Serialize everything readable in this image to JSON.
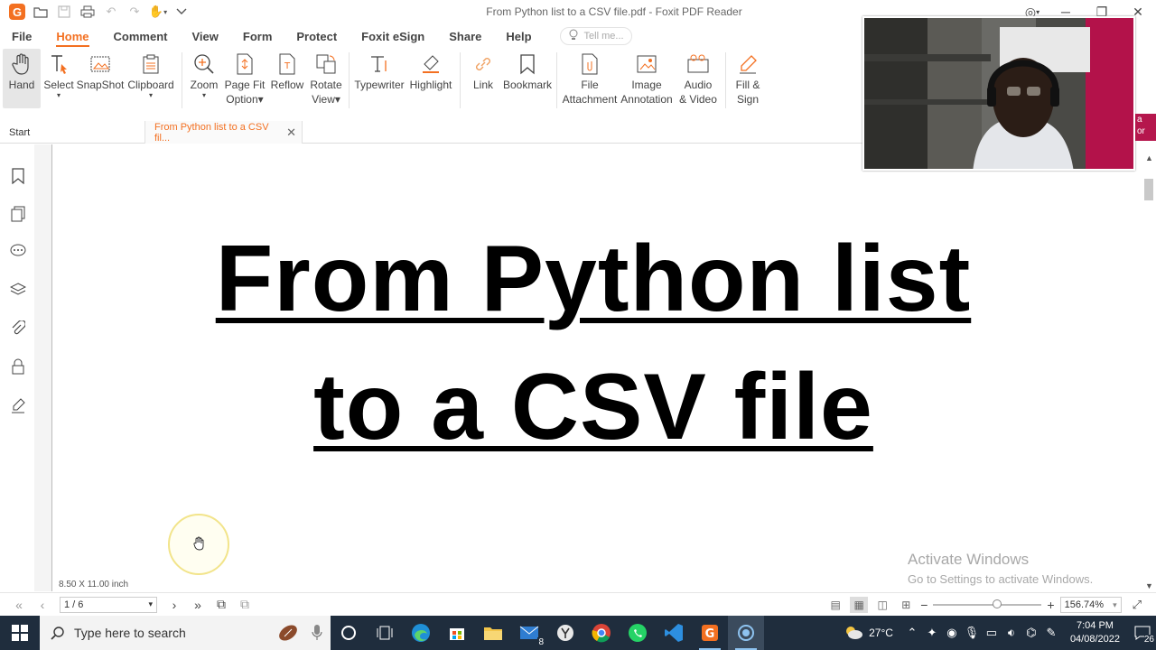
{
  "window": {
    "title": "From Python list to a CSV file.pdf - Foxit PDF Reader"
  },
  "menu": {
    "items": [
      "File",
      "Home",
      "Comment",
      "View",
      "Form",
      "Protect",
      "Foxit eSign",
      "Share",
      "Help"
    ],
    "active": "Home",
    "tell_me": "Tell me..."
  },
  "ribbon": {
    "hand": "Hand",
    "select": "Select",
    "snapshot": "SnapShot",
    "clipboard": "Clipboard",
    "zoom": "Zoom",
    "page_fit_1": "Page Fit",
    "page_fit_2": "Option",
    "reflow": "Reflow",
    "rotate_1": "Rotate",
    "rotate_2": "View",
    "typewriter": "Typewriter",
    "highlight": "Highlight",
    "link": "Link",
    "bookmark": "Bookmark",
    "file_att_1": "File",
    "file_att_2": "Attachment",
    "image_ann_1": "Image",
    "image_ann_2": "Annotation",
    "audio_1": "Audio",
    "audio_2": "& Video",
    "fill_1": "Fill &",
    "fill_2": "Sign"
  },
  "tabs": {
    "start": "Start",
    "doc": "From Python list to a CSV fil..."
  },
  "document": {
    "title_line1": "From Python list",
    "title_line2": "to a CSV file",
    "page_size": "8.50 X 11.00 inch"
  },
  "watermark": {
    "line1": "Activate Windows",
    "line2": "Go to Settings to activate Windows."
  },
  "overlay_strip": {
    "line1": "a",
    "line2": "or"
  },
  "statusbar": {
    "page": "1 / 6",
    "zoom": "156.74%"
  },
  "taskbar": {
    "search_placeholder": "Type here to search",
    "mail_badge": "8",
    "weather": "27°C",
    "time": "7:04 PM",
    "date": "04/08/2022",
    "notifications": "26"
  }
}
